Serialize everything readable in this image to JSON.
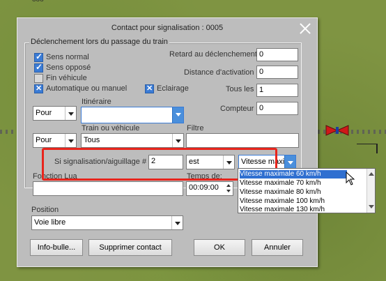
{
  "background": {
    "corner_label": "ooo"
  },
  "dialog": {
    "title": "Contact pour signalisation : 0005",
    "trigger_group_label": "Déclenchement lors du passage du train",
    "checkboxes": {
      "sens_normal": {
        "label": "Sens normal",
        "checked": true
      },
      "sens_oppose": {
        "label": "Sens opposé",
        "checked": true
      },
      "fin_vehicule": {
        "label": "Fin véhicule",
        "checked": false
      },
      "auto_manuel": {
        "label": "Automatique ou manuel",
        "checked": true
      },
      "eclairage": {
        "label": "Eclairage",
        "checked": true
      }
    },
    "retard_label": "Retard au déclenchement",
    "retard_value": "0",
    "distance_label": "Distance d'activation",
    "distance_value": "0",
    "tous_les_label": "Tous les",
    "tous_les_value": "1",
    "compteur_label": "Compteur",
    "compteur_value": "0",
    "pour1_value": "Pour",
    "itineraire_label": "Itinéraire",
    "itineraire_value": "",
    "pour2_value": "Pour",
    "train_label": "Train ou véhicule",
    "train_value": "Tous",
    "filtre_label": "Filtre",
    "filtre_value": "",
    "signal_label": "Si signalisation/aiguillage #",
    "signal_value": "2",
    "est_value": "est",
    "vitesse_value": "Vitesse maxir",
    "fonction_lua_label": "Fonction Lua",
    "fonction_lua_value": "",
    "temps_label": "Temps de:",
    "temps_value": "00:09:00",
    "position_group_label": "Position",
    "position_value": "Voie libre",
    "buttons": {
      "info_bulle": "Info-bulle...",
      "supprimer": "Supprimer contact",
      "ok": "OK",
      "annuler": "Annuler"
    }
  },
  "dropdown_options": [
    "Vitesse maximale 60 km/h",
    "Vitesse maximale 70 km/h",
    "Vitesse maximale 80 km/h",
    "Vitesse maximale 100 km/h",
    "Vitesse maximale 130 km/h"
  ],
  "colors": {
    "highlight": "#e8241c",
    "selection": "#2f6fd0"
  }
}
